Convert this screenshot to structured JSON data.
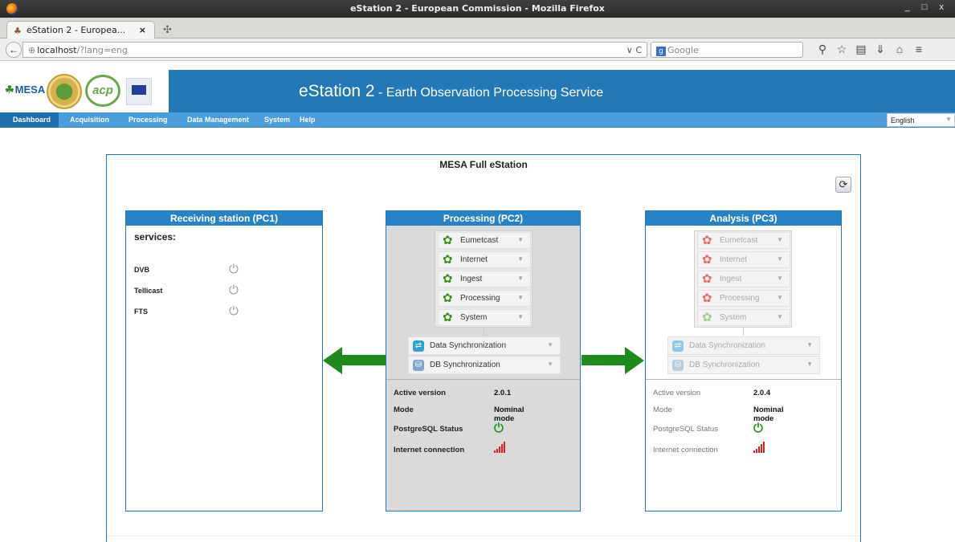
{
  "browser": {
    "window_title": "eStation 2 - European Commission - Mozilla Firefox",
    "window_controls": "_ □ x",
    "tab_title": "eStation 2 - Europea...",
    "tab_close": "×",
    "new_tab": "✣",
    "url_host": "localhost",
    "url_path": "/?lang=eng",
    "url_controls": "∨ C",
    "search_placeholder": "Google",
    "search_engine": "g"
  },
  "header": {
    "logo_mesa": "MESA",
    "logo_acp": "acp",
    "title_main": "eStation 2",
    "title_sep": " - ",
    "title_sub": "Earth Observation Processing Service"
  },
  "menu": {
    "items": [
      "Dashboard",
      "Acquisition",
      "Processing",
      "Data Management",
      "System",
      "Help"
    ],
    "active": "Dashboard",
    "language": "English"
  },
  "panel": {
    "title": "MESA Full eStation",
    "refresh_icon": "refresh-icon"
  },
  "pc1": {
    "title": "Receiving station (PC1)",
    "services_label": "services:",
    "services": [
      {
        "name": "DVB",
        "icon": "power-icon"
      },
      {
        "name": "Tellicast",
        "icon": "power-icon"
      },
      {
        "name": "FTS",
        "icon": "power-icon"
      }
    ]
  },
  "pc2": {
    "title": "Processing (PC2)",
    "services": [
      {
        "name": "Eumetcast",
        "status_color": "#3a8e1e"
      },
      {
        "name": "Internet",
        "status_color": "#3a8e1e"
      },
      {
        "name": "Ingest",
        "status_color": "#3a8e1e"
      },
      {
        "name": "Processing",
        "status_color": "#3a8e1e"
      },
      {
        "name": "System",
        "status_color": "#3a8e1e"
      }
    ],
    "sync": [
      {
        "name": "Data Synchronization"
      },
      {
        "name": "DB Synchronization"
      }
    ],
    "info": {
      "active_version_label": "Active version",
      "active_version": "2.0.1",
      "mode_label": "Mode",
      "mode": "Nominal mode",
      "postgres_label": "PostgreSQL Status",
      "internet_label": "Internet connection"
    }
  },
  "pc3": {
    "title": "Analysis (PC3)",
    "services": [
      {
        "name": "Eumetcast",
        "status_color": "#e86a6a"
      },
      {
        "name": "Internet",
        "status_color": "#e86a6a"
      },
      {
        "name": "Ingest",
        "status_color": "#e86a6a"
      },
      {
        "name": "Processing",
        "status_color": "#e86a6a"
      },
      {
        "name": "System",
        "status_color": "#9ccf88"
      }
    ],
    "sync": [
      {
        "name": "Data Synchronization"
      },
      {
        "name": "DB Synchronization"
      }
    ],
    "info": {
      "active_version_label": "Active version",
      "active_version": "2.0.4",
      "mode_label": "Mode",
      "mode": "Nominal mode",
      "postgres_label": "PostgreSQL Status",
      "internet_label": "Internet connection"
    }
  },
  "colors": {
    "header_blue": "#2378b8",
    "menu_blue": "#4a9ddc",
    "arrow_green": "#1e8a1e",
    "ok_green": "#1c9c1c",
    "signal_red": "#e02020"
  }
}
